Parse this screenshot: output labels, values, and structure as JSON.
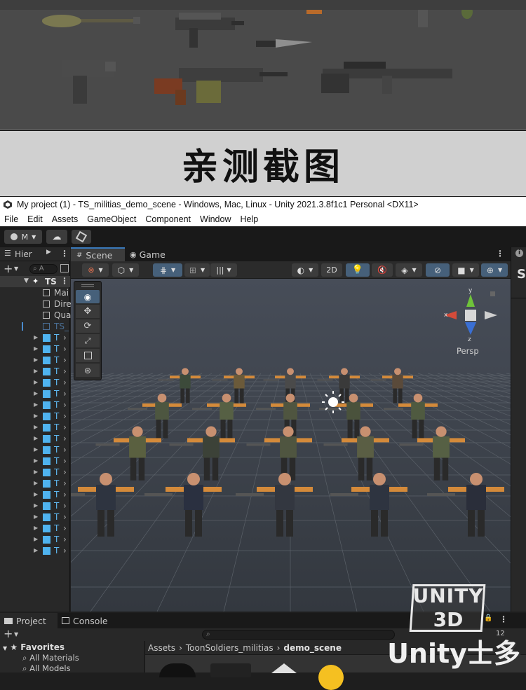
{
  "banner": {
    "text": "亲测截图"
  },
  "window": {
    "title": "My project (1) - TS_militias_demo_scene - Windows, Mac, Linux - Unity 2021.3.8f1c1 Personal <DX11>"
  },
  "menu": [
    "File",
    "Edit",
    "Assets",
    "GameObject",
    "Component",
    "Window",
    "Help"
  ],
  "toolbar": {
    "account": "M"
  },
  "hierarchy": {
    "tab": "Hier",
    "search_placeholder": "A",
    "root": "TS",
    "children": [
      "Mai",
      "Dire",
      "Qua"
    ],
    "selected": "TS_",
    "prefab_label": "T",
    "prefab_count": 20
  },
  "scene": {
    "tabs": [
      "Scene",
      "Game"
    ],
    "mode_2d": "2D",
    "projection": "Persp",
    "gizmo_axes": {
      "y": "y",
      "x": "x",
      "z": "z"
    }
  },
  "project": {
    "tabs": [
      "Project",
      "Console"
    ],
    "favorites": "Favorites",
    "fav_items": [
      "All Materials",
      "All Models"
    ],
    "breadcrumb": [
      "Assets",
      "ToonSoldiers_militias",
      "demo_scene"
    ],
    "count": "12"
  },
  "watermark": {
    "line1": "UNITY",
    "line2": "3D",
    "line3": "Unity士多"
  },
  "colors": {
    "accent": "#2c5d87",
    "selected_blue": "#4a8ccf",
    "prefab_cube": "#4fb3ef"
  }
}
